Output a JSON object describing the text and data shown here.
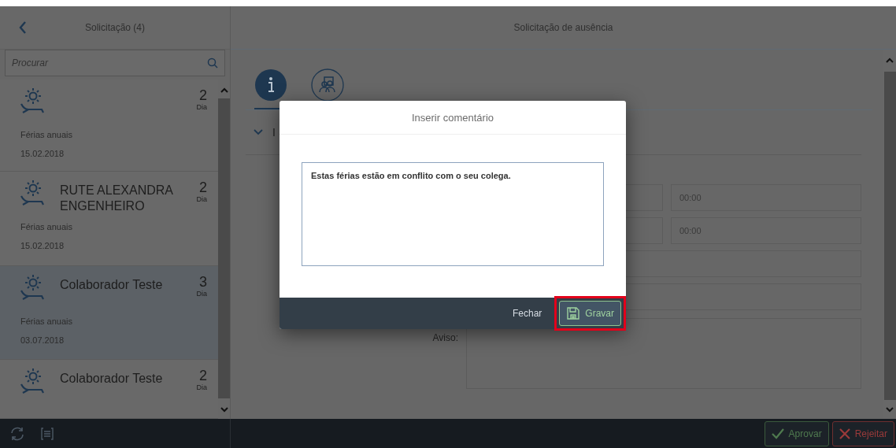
{
  "list_panel": {
    "title": "Solicitação (4)",
    "search": {
      "placeholder": "Procurar"
    },
    "items": [
      {
        "days": "2",
        "unit": "Dia",
        "type": "Férias anuais",
        "date": "15.02.2018",
        "selected": false
      },
      {
        "name": "RUTE ALEXANDRA ENGENHEIRO",
        "days": "2",
        "unit": "Dia",
        "type": "Férias anuais",
        "date": "15.02.2018",
        "selected": false
      },
      {
        "name": "Colaborador Teste",
        "days": "3",
        "unit": "Dia",
        "type": "Férias anuais",
        "date": "03.07.2018",
        "selected": true
      },
      {
        "name": "Colaborador Teste",
        "days": "2",
        "unit": "Dia",
        "selected": false
      }
    ]
  },
  "detail": {
    "title": "Solicitação de ausência",
    "tabs": [
      {
        "kind": "info",
        "selected": true
      },
      {
        "kind": "people",
        "selected": false
      }
    ],
    "section_label": "I",
    "rows": [
      {
        "kind": "pair",
        "value": "00:00"
      },
      {
        "kind": "pair",
        "value": "00:00"
      },
      {
        "kind": "single"
      },
      {
        "kind": "single"
      },
      {
        "kind": "area",
        "label": "Aviso:"
      }
    ]
  },
  "dialog": {
    "title": "Inserir comentário",
    "comment": "Estas férias estão em conflito com o seu colega.",
    "buttons": [
      {
        "label": "Fechar",
        "kind": "plain"
      },
      {
        "label": "Gravar",
        "kind": "save",
        "highlighted": true
      }
    ]
  },
  "footer": {
    "buttons": [
      {
        "label": "Aprovar",
        "kind": "approve"
      },
      {
        "label": "Rejeitar",
        "kind": "reject"
      }
    ]
  }
}
